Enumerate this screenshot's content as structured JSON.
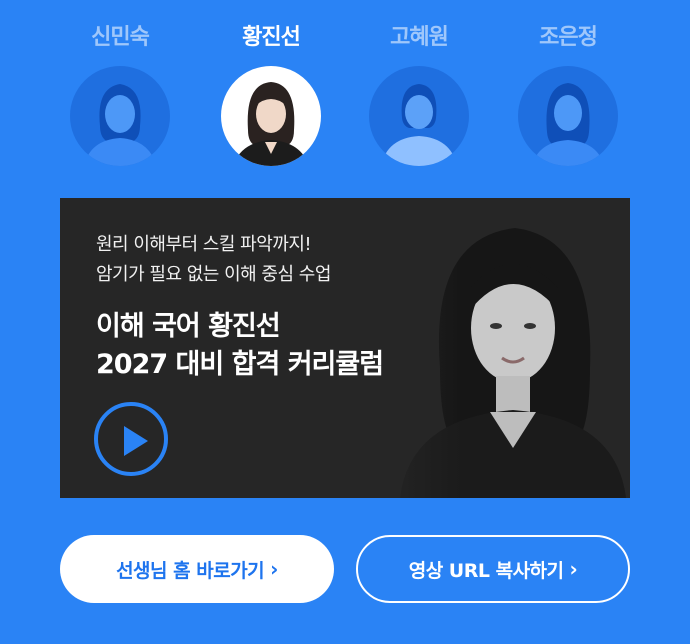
{
  "teachers": [
    {
      "name": "신민숙",
      "active": false
    },
    {
      "name": "황진선",
      "active": true
    },
    {
      "name": "고혜원",
      "active": false
    },
    {
      "name": "조은정",
      "active": false
    }
  ],
  "video": {
    "subtitle_line1": "원리 이해부터 스킬 파악까지!",
    "subtitle_line2": "암기가 필요 없는 이해 중심 수업",
    "title_line1": "이해 국어 황진선",
    "title_line2": "2027 대비 합격 커리큘럼"
  },
  "buttons": {
    "home_label": "선생님 홈 바로가기",
    "copy_label": "영상 URL 복사하기",
    "chevron": "›"
  },
  "colors": {
    "background": "#2a83f5",
    "card": "#262626",
    "accent": "#2a83f5",
    "button_text": "#1e74ee"
  },
  "icons": [
    "play-icon",
    "chevron-right-icon"
  ]
}
